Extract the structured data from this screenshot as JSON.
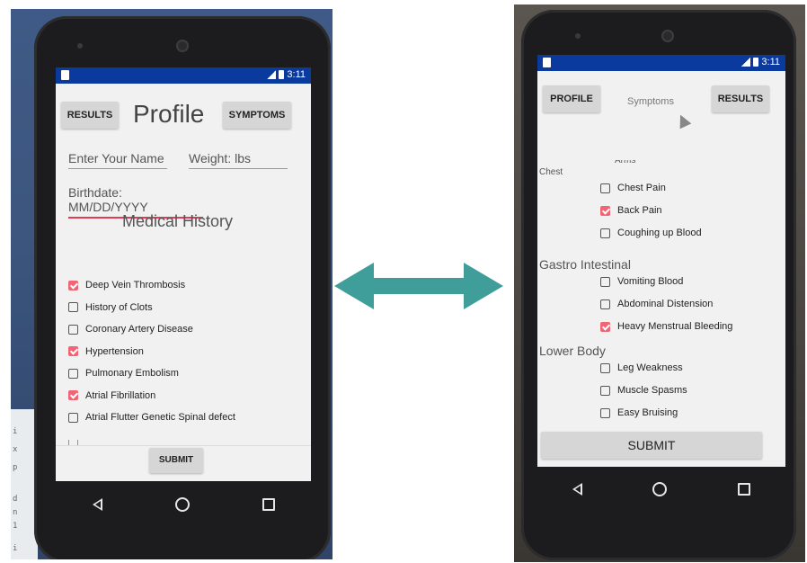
{
  "left_app": {
    "status_time": "3:11",
    "results_button": "RESULTS",
    "title": "Profile",
    "symptoms_button": "SYMPTOMS",
    "name_placeholder": "Enter Your Name",
    "weight_placeholder": "Weight: lbs",
    "birthdate_placeholder": "Birthdate: MM/DD/YYYY",
    "section_title": "Medical History",
    "history": [
      {
        "label": "Deep Vein Thrombosis",
        "checked": true
      },
      {
        "label": "History of Clots",
        "checked": false
      },
      {
        "label": "Coronary Artery Disease",
        "checked": false
      },
      {
        "label": "Hypertension",
        "checked": true
      },
      {
        "label": "Pulmonary Embolism",
        "checked": false
      },
      {
        "label": "Atrial Fibrillation",
        "checked": true
      },
      {
        "label": "Atrial Flutter Genetic Spinal defect",
        "checked": false
      }
    ],
    "submit": "SUBMIT"
  },
  "right_app": {
    "status_time": "3:11",
    "profile_button": "PROFILE",
    "title": "Symptoms",
    "results_button": "RESULTS",
    "partial_item": "Arms",
    "sections": [
      {
        "name": "Chest",
        "items": [
          {
            "label": "Chest Pain",
            "checked": false
          },
          {
            "label": "Back Pain",
            "checked": true
          },
          {
            "label": "Coughing up Blood",
            "checked": false
          }
        ]
      },
      {
        "name": "Gastro Intestinal",
        "items": [
          {
            "label": "Vomiting Blood",
            "checked": false
          },
          {
            "label": "Abdominal Distension",
            "checked": false
          },
          {
            "label": "Heavy Menstrual Bleeding",
            "checked": true
          }
        ]
      },
      {
        "name": "Lower Body",
        "items": [
          {
            "label": "Leg Weakness",
            "checked": false
          },
          {
            "label": "Muscle Spasms",
            "checked": false
          },
          {
            "label": "Easy Bruising",
            "checked": false
          }
        ]
      }
    ],
    "submit": "SUBMIT"
  },
  "colors": {
    "status_bar": "#0b3a9e",
    "checkbox_checked": "#f06473",
    "arrow": "#3f9e9a",
    "input_active_underline": "#e53955"
  }
}
